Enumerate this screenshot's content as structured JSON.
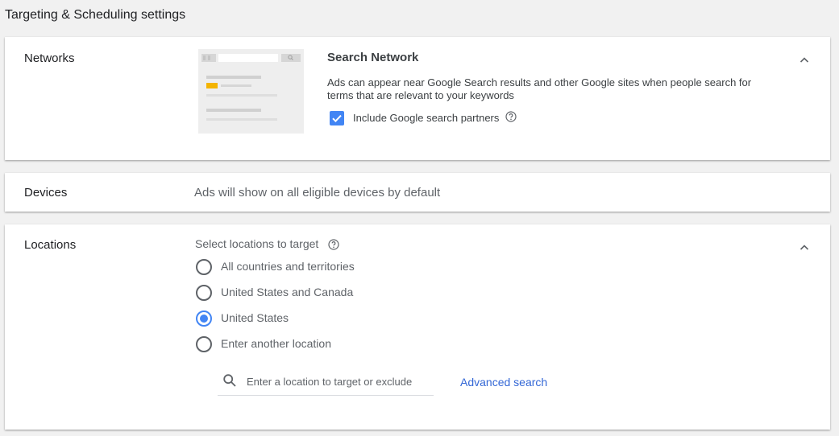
{
  "page": {
    "title": "Targeting & Scheduling settings"
  },
  "networks": {
    "label": "Networks",
    "heading": "Search Network",
    "description": "Ads can appear near Google Search results and other Google sites when people search for terms that are relevant to your keywords",
    "partners_checkbox": {
      "label": "Include Google search partners",
      "checked": true
    },
    "colors": {
      "accent": "#4285f4",
      "illustration_bg": "#eeeeee",
      "illustration_highlight": "#f4b400"
    }
  },
  "devices": {
    "label": "Devices",
    "text": "Ads will show on all eligible devices by default"
  },
  "locations": {
    "label": "Locations",
    "prompt": "Select locations to target",
    "options": [
      {
        "label": "All countries and territories",
        "selected": false
      },
      {
        "label": "United States and Canada",
        "selected": false
      },
      {
        "label": "United States",
        "selected": true
      },
      {
        "label": "Enter another location",
        "selected": false
      }
    ],
    "search": {
      "placeholder": "Enter a location to target or exclude",
      "value": ""
    },
    "advanced_search_label": "Advanced search"
  }
}
